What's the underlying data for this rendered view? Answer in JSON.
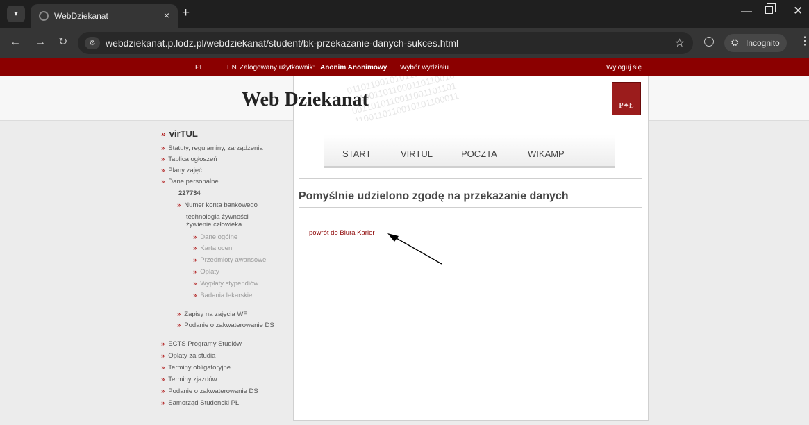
{
  "browser": {
    "tab_title": "WebDziekanat",
    "tab_close": "×",
    "new_tab": "+",
    "url": "webdziekanat.p.lodz.pl/webdziekanat/student/bk-przekazanie-danych-sukces.html",
    "incognito_label": "Incognito",
    "icons": [
      "tab-menu-icon",
      "favicon-icon",
      "back-icon",
      "forward-icon",
      "reload-icon",
      "site-info-icon",
      "bookmark-star-icon",
      "extensions-icon",
      "incognito-icon",
      "menu-kebab-icon",
      "minimize-icon",
      "maximize-icon",
      "close-icon"
    ]
  },
  "topbar": {
    "lang_pl": "PL",
    "lang_en": "EN",
    "logged_in_label": "Zalogowany użytkownik:",
    "user_name": "Anonim Anonimowy",
    "faculty_choice": "Wybór wydziału",
    "logout": "Wyloguj się"
  },
  "header": {
    "title": "Web Dziekanat",
    "binary_1": "0110110010101101100101",
    "binary_2": "1010011011000110110010",
    "binary_3": "0011010110011001101101",
    "binary_4": "1100110110010101100011",
    "emblem_text": "P✦Ł"
  },
  "menu": {
    "start": "START",
    "virtul": "VIRTUL",
    "poczta": "POCZTA",
    "wikamp": "WIKAMP"
  },
  "main": {
    "heading": "Pomyślnie udzielono zgodę na przekazanie danych",
    "back_link": "powrót do Biura Karier"
  },
  "sidebar": {
    "bullet": "»",
    "virtul": "virTUL",
    "statuty": "Statuty, regulaminy, zarządzenia",
    "tablica": "Tablica ogłoszeń",
    "plany": "Plany zajęć",
    "dane_personalne": "Dane personalne",
    "student_number": "227734",
    "numer_konta": "Numer konta bankowego",
    "kierunek_1": "technologia żywności i",
    "kierunek_2": "żywienie człowieka",
    "dane_ogolne": "Dane ogólne",
    "karta_ocen": "Karta ocen",
    "przedmioty": "Przedmioty awansowe",
    "oplaty": "Opłaty",
    "wyplaty": "Wypłaty stypendiów",
    "badania": "Badania lekarskie",
    "zapisy_wf": "Zapisy na zajęcia WF",
    "podanie_1": "Podanie o zakwaterowanie DS",
    "ects": "ECTS Programy Studiów",
    "oplaty_studia": "Opłaty za studia",
    "terminy_obl": "Terminy obligatoryjne",
    "terminy_zj": "Terminy zjazdów",
    "podanie_2": "Podanie o zakwaterowanie DS",
    "samorzad": "Samorząd Studencki PŁ"
  }
}
